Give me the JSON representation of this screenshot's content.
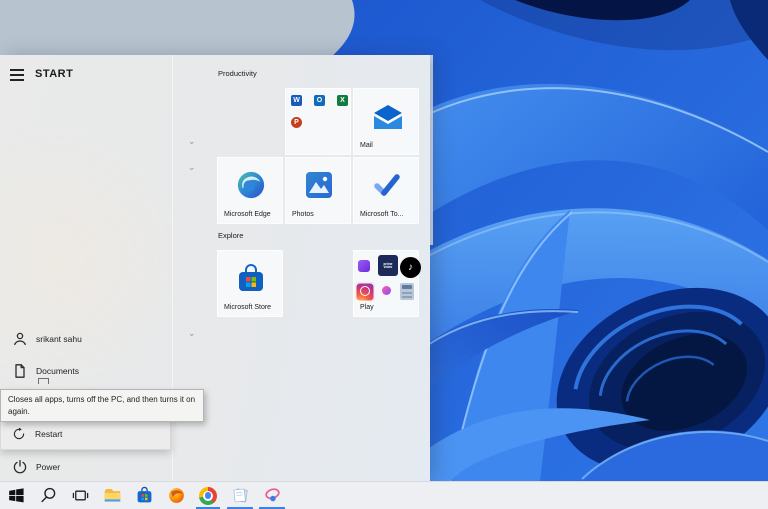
{
  "colors": {
    "menu_bg": "#e8eaec",
    "tile_bg": "#f4f7f9",
    "taskbar_bg": "#edeff3",
    "running_indicator": "#3b82e8",
    "wallpaper_light": "#b7c4d0",
    "wallpaper_blue": "#2268e3"
  },
  "start_menu": {
    "title": "START",
    "menu_icon": "hamburger-icon",
    "user": {
      "name": "srikant sahu",
      "icon": "user-icon"
    },
    "items": [
      {
        "label": "Documents",
        "icon": "document-icon"
      }
    ],
    "power": {
      "label": "Power",
      "icon": "power-icon"
    },
    "power_flyout": {
      "restart_label": "Restart",
      "restart_icon": "restart-icon"
    },
    "tooltip": {
      "text": "Closes all apps, turns off the PC, and then turns it on again."
    },
    "groups": [
      {
        "label": "Productivity"
      },
      {
        "label": "Explore"
      }
    ],
    "tiles": {
      "office": {
        "icons": [
          "word-icon",
          "outlook-icon",
          "excel-icon",
          "powerpoint-icon"
        ]
      },
      "mail": {
        "label": "Mail",
        "icon": "mail-icon"
      },
      "edge": {
        "label": "Microsoft Edge",
        "icon": "edge-icon"
      },
      "photos": {
        "label": "Photos",
        "icon": "photos-icon"
      },
      "todo": {
        "label": "Microsoft To...",
        "icon": "todo-check-icon"
      },
      "store": {
        "label": "Microsoft Store",
        "icon": "store-bag-icon"
      },
      "play": {
        "label": "Play",
        "prime_video_text": "prime video",
        "tiktok_glyph": "♪",
        "icons": [
          "clipchamp-icon",
          "prime-video-icon",
          "tiktok-icon",
          "instagram-icon",
          "messenger-icon",
          "calculator-icon"
        ]
      }
    },
    "chevron_icon": "chevron-down-icon"
  },
  "taskbar": {
    "icons": [
      "start-button",
      "search-icon",
      "task-view-icon",
      "file-explorer-icon",
      "store-icon",
      "firefox-icon",
      "chrome-icon",
      "notepad-icon",
      "paint-icon"
    ],
    "running_apps": [
      "chrome",
      "notepad",
      "paint"
    ]
  }
}
